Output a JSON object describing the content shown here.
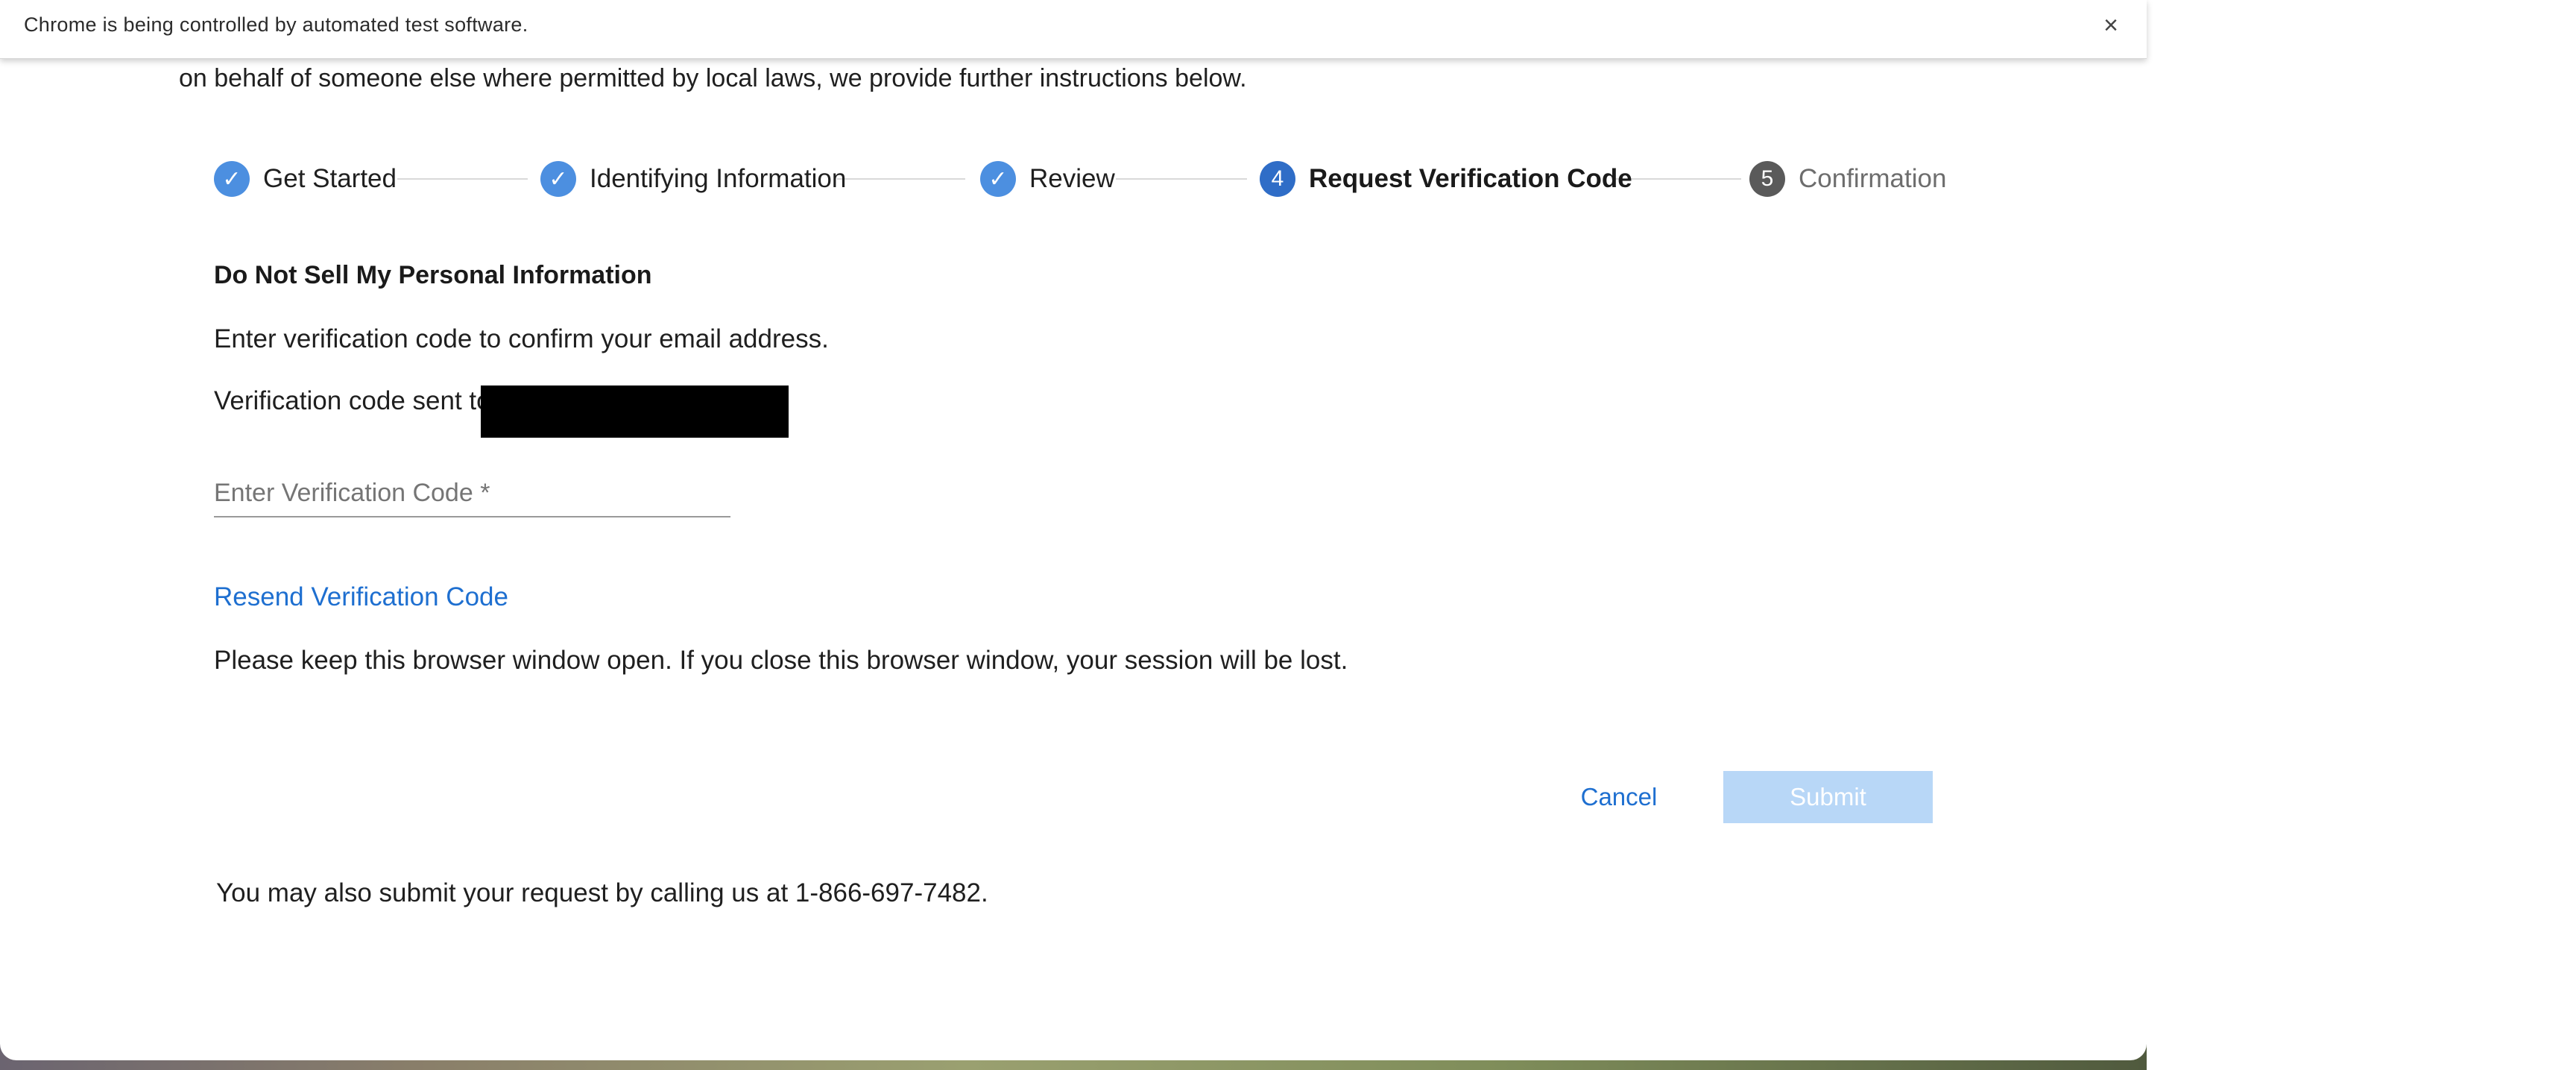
{
  "infobar": {
    "message": "Chrome is being controlled by automated test software.",
    "close_glyph": "×"
  },
  "intro": {
    "line": "on behalf of someone else where permitted by local laws, we provide further instructions below."
  },
  "stepper": {
    "steps": [
      {
        "label": "Get Started",
        "state": "done",
        "marker": "✓"
      },
      {
        "label": "Identifying Information",
        "state": "done",
        "marker": "✓"
      },
      {
        "label": "Review",
        "state": "done",
        "marker": "✓"
      },
      {
        "label": "Request Verification Code",
        "state": "current",
        "marker": "4"
      },
      {
        "label": "Confirmation",
        "state": "future",
        "marker": "5"
      }
    ]
  },
  "form": {
    "heading": "Do Not Sell My Personal Information",
    "instruction": "Enter verification code to confirm your email address.",
    "sent_to_label": "Verification code sent to:",
    "code_placeholder": "Enter Verification Code *",
    "code_value": "",
    "resend_label": "Resend Verification Code",
    "keep_open_notice": "Please keep this browser window open. If you close this browser window, your session will be lost."
  },
  "actions": {
    "cancel_label": "Cancel",
    "submit_label": "Submit"
  },
  "footer": {
    "call_text": "You may also submit your request by calling us at 1-866-697-7482."
  },
  "colors": {
    "link": "#1e6fd0",
    "step_done": "#4c8fe0",
    "step_current": "#2f6dc7",
    "step_future": "#5a5a5a",
    "submit_disabled": "#b8d7f7"
  }
}
